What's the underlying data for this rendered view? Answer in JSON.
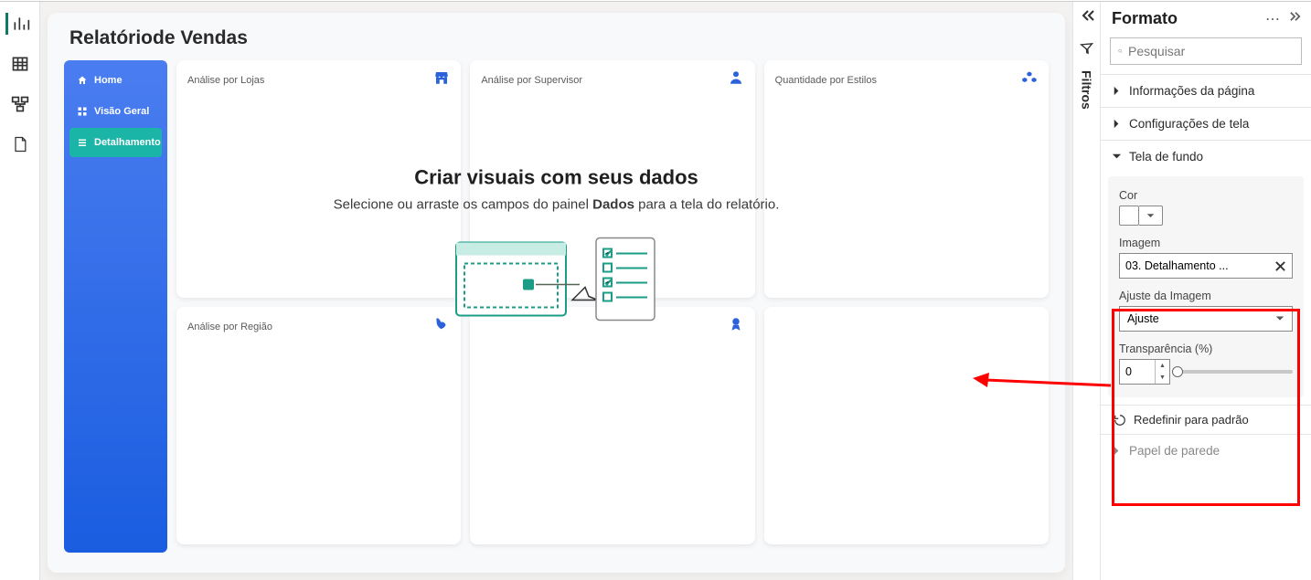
{
  "report": {
    "title": "Relatóriode Vendas",
    "nav": {
      "home": "Home",
      "visao": "Visão Geral",
      "detalhamento": "Detalhamento"
    },
    "cards": {
      "lojas": "Análise por Lojas",
      "supervisor": "Análise por Supervisor",
      "estilos": "Quantidade por Estilos",
      "regiao": "Análise por Região"
    }
  },
  "overlay": {
    "heading": "Criar visuais com seus dados",
    "text_pre": "Selecione ou arraste os campos do painel ",
    "text_bold": "Dados",
    "text_post": " para a tela do relatório."
  },
  "filters_label": "Filtros",
  "format": {
    "title": "Formato",
    "search_placeholder": "Pesquisar",
    "section_page_info": "Informações da página",
    "section_screen": "Configurações de tela",
    "section_bg": "Tela de fundo",
    "color_label": "Cor",
    "image_label": "Imagem",
    "image_value": "03. Detalhamento ...",
    "fit_label": "Ajuste da Imagem",
    "fit_value": "Ajuste",
    "transparency_label": "Transparência (%)",
    "transparency_value": "0",
    "reset": "Redefinir para padrão",
    "wall": "Papel de parede"
  }
}
